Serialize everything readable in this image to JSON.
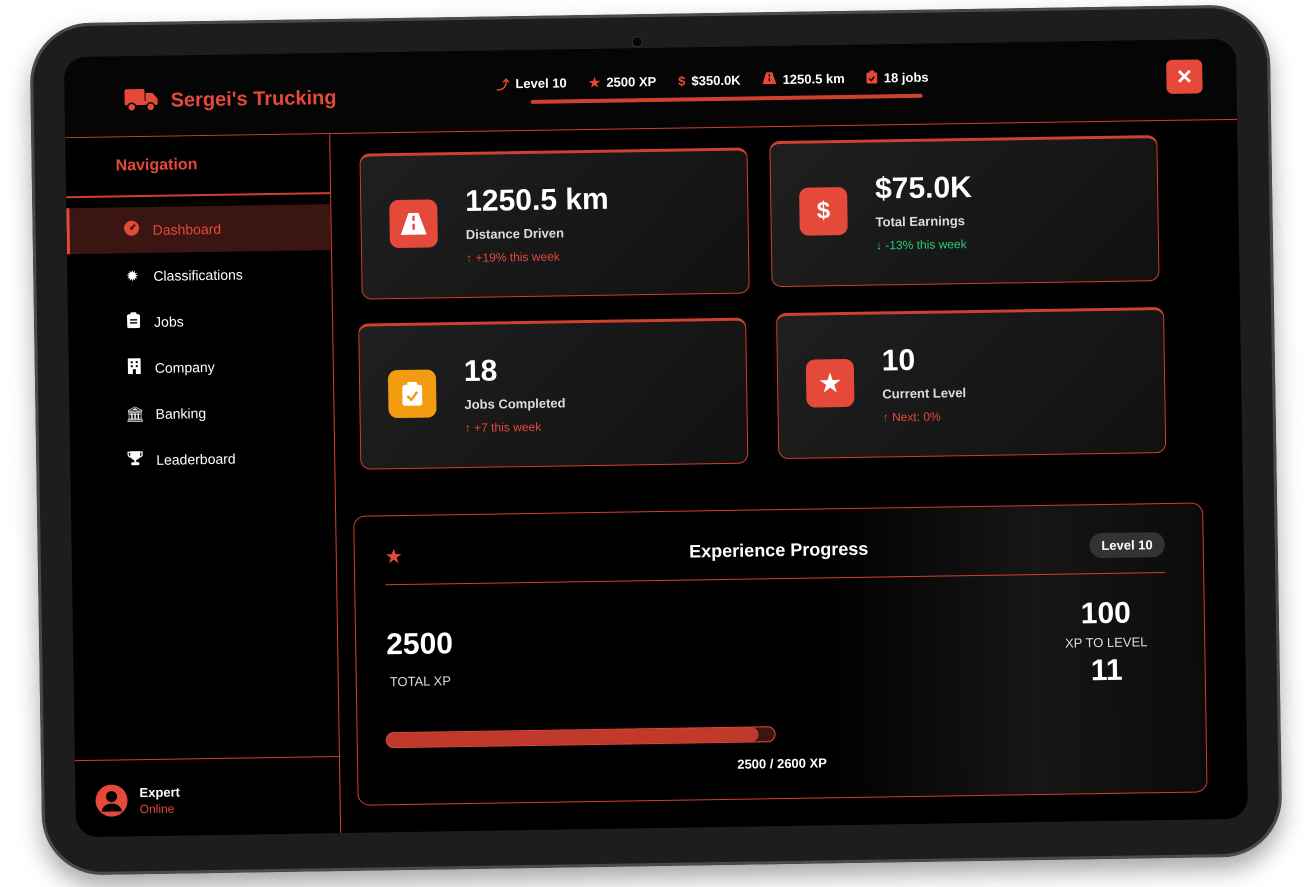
{
  "header": {
    "brand": "Sergei's Trucking",
    "stats": {
      "level": "Level 10",
      "xp": "2500 XP",
      "money": "$350.0K",
      "distance": "1250.5 km",
      "jobs": "18 jobs"
    },
    "close_icon": "close-icon"
  },
  "sidebar": {
    "title": "Navigation",
    "items": [
      {
        "label": "Dashboard",
        "icon": "speedometer-icon",
        "active": true
      },
      {
        "label": "Classifications",
        "icon": "badge-icon"
      },
      {
        "label": "Jobs",
        "icon": "clipboard-icon"
      },
      {
        "label": "Company",
        "icon": "building-icon"
      },
      {
        "label": "Banking",
        "icon": "bank-icon"
      },
      {
        "label": "Leaderboard",
        "icon": "trophy-icon"
      }
    ],
    "user": {
      "name": "Expert",
      "status": "Online"
    }
  },
  "cards": [
    {
      "value": "1250.5 km",
      "label": "Distance Driven",
      "trend": "↑ +19% this week",
      "icon": "road-icon"
    },
    {
      "value": "$75.0K",
      "label": "Total Earnings",
      "trend": "↓ -13% this week",
      "icon": "dollar-icon"
    },
    {
      "value": "18",
      "label": "Jobs Completed",
      "trend": "↑ +7 this week",
      "icon": "clipboard-check-icon"
    },
    {
      "value": "10",
      "label": "Current Level",
      "trend": "↑ Next: 0%",
      "icon": "star-icon"
    }
  ],
  "xp": {
    "title": "Experience Progress",
    "badge": "Level 10",
    "total": "2500",
    "total_label": "TOTAL XP",
    "remaining": "100",
    "remaining_label": "XP TO LEVEL",
    "next_level": "11",
    "progress_label": "2500 / 2600 XP",
    "progress_fraction": 0.96
  },
  "colors": {
    "accent": "#e4493a",
    "positive": "#2ecc71",
    "jobs_icon": "#f39c12"
  }
}
